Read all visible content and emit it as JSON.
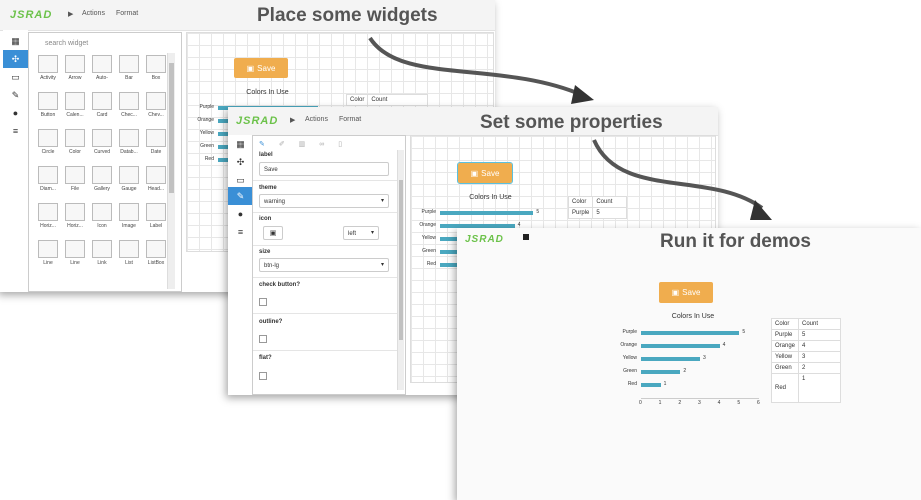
{
  "titles": {
    "step1": "Place some widgets",
    "step2": "Set some properties",
    "step3": "Run it for demos"
  },
  "app": {
    "logo": "JSRAD",
    "menu_actions": "Actions",
    "menu_format": "Format",
    "play_icon": "play-icon"
  },
  "palette": {
    "search_placeholder": "search widget",
    "tooltip": "widgets",
    "widgets": [
      "Activity",
      "Arrow",
      "Auto-",
      "Bar",
      "Box",
      "Button",
      "Calen...",
      "Card",
      "Chec...",
      "Chev...",
      "Circle",
      "Color",
      "Curved",
      "Datab...",
      "Date",
      "Diam...",
      "File",
      "Gallery",
      "Gauge",
      "Head...",
      "Horiz...",
      "Horiz...",
      "Icon",
      "Image",
      "Label",
      "Line",
      "Line",
      "Link",
      "List",
      "ListBox"
    ]
  },
  "preview_texts": {
    "field": "Field",
    "check": "Check",
    "button": "Button",
    "heading": "Heading 1",
    "label": "Label 1",
    "choose_file": "Choose File",
    "link": "http://"
  },
  "properties": {
    "label_label": "label",
    "label_value": "Save",
    "theme_label": "theme",
    "theme_value": "warning",
    "icon_label": "icon",
    "icon_align": "left",
    "size_label": "size",
    "size_value": "btn-lg",
    "check_button_label": "check button?",
    "outline_label": "outline?",
    "flat_label": "flat?"
  },
  "save_label": "Save",
  "chart_data": {
    "type": "bar",
    "orientation": "horizontal",
    "title": "Colors In Use",
    "categories": [
      "Purple",
      "Orange",
      "Yellow",
      "Green",
      "Red"
    ],
    "values": [
      5,
      4,
      3,
      2,
      1
    ],
    "xlim": [
      0,
      6
    ],
    "xticks": [
      "0",
      "1",
      "2",
      "3",
      "4",
      "5",
      "6"
    ],
    "bar_color": "#4aa8c0"
  },
  "table": {
    "headers": [
      "Color",
      "Count"
    ],
    "rows": [
      [
        "Purple",
        "5"
      ],
      [
        "Orange",
        "4"
      ],
      [
        "Yellow",
        "3"
      ],
      [
        "Green",
        "2"
      ],
      [
        "Red",
        "1"
      ]
    ]
  },
  "colors": {
    "accent": "#3a8fd6",
    "warning": "#f0ad4e",
    "logo": "#6cc24a"
  }
}
